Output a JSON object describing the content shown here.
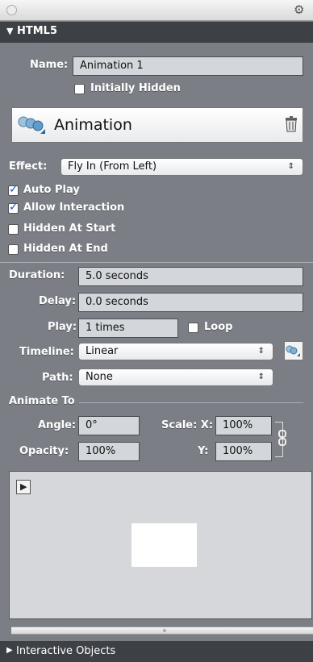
{
  "titlebar": {
    "gear_icon": "gear-icon"
  },
  "html5_section": {
    "header": "HTML5",
    "name_label": "Name:",
    "name_value": "Animation 1",
    "initially_hidden": "Initially Hidden"
  },
  "animation": {
    "title": "Animation",
    "effect_label": "Effect:",
    "effect_value": "Fly In (From Left)",
    "auto_play": "Auto Play",
    "allow_interaction": "Allow Interaction",
    "hidden_at_start": "Hidden At Start",
    "hidden_at_end": "Hidden At End",
    "duration_label": "Duration:",
    "duration_value": "5.0 seconds",
    "delay_label": "Delay:",
    "delay_value": "0.0 seconds",
    "play_label": "Play:",
    "play_value": "1 times",
    "loop": "Loop",
    "timeline_label": "Timeline:",
    "timeline_value": "Linear",
    "path_label": "Path:",
    "path_value": "None"
  },
  "animate_to": {
    "header": "Animate To",
    "angle_label": "Angle:",
    "angle_value": "0°",
    "opacity_label": "Opacity:",
    "opacity_value": "100%",
    "scale_label": "Scale: X:",
    "scale_x_value": "100%",
    "y_label": "Y:",
    "scale_y_value": "100%"
  },
  "footer": {
    "interactive_objects": "Interactive Objects"
  },
  "colors": {
    "panel_bg": "#7b7f85",
    "header_bg": "#3d4045",
    "field_bg": "#d3d6da",
    "preview_bg": "#d5d7db"
  }
}
